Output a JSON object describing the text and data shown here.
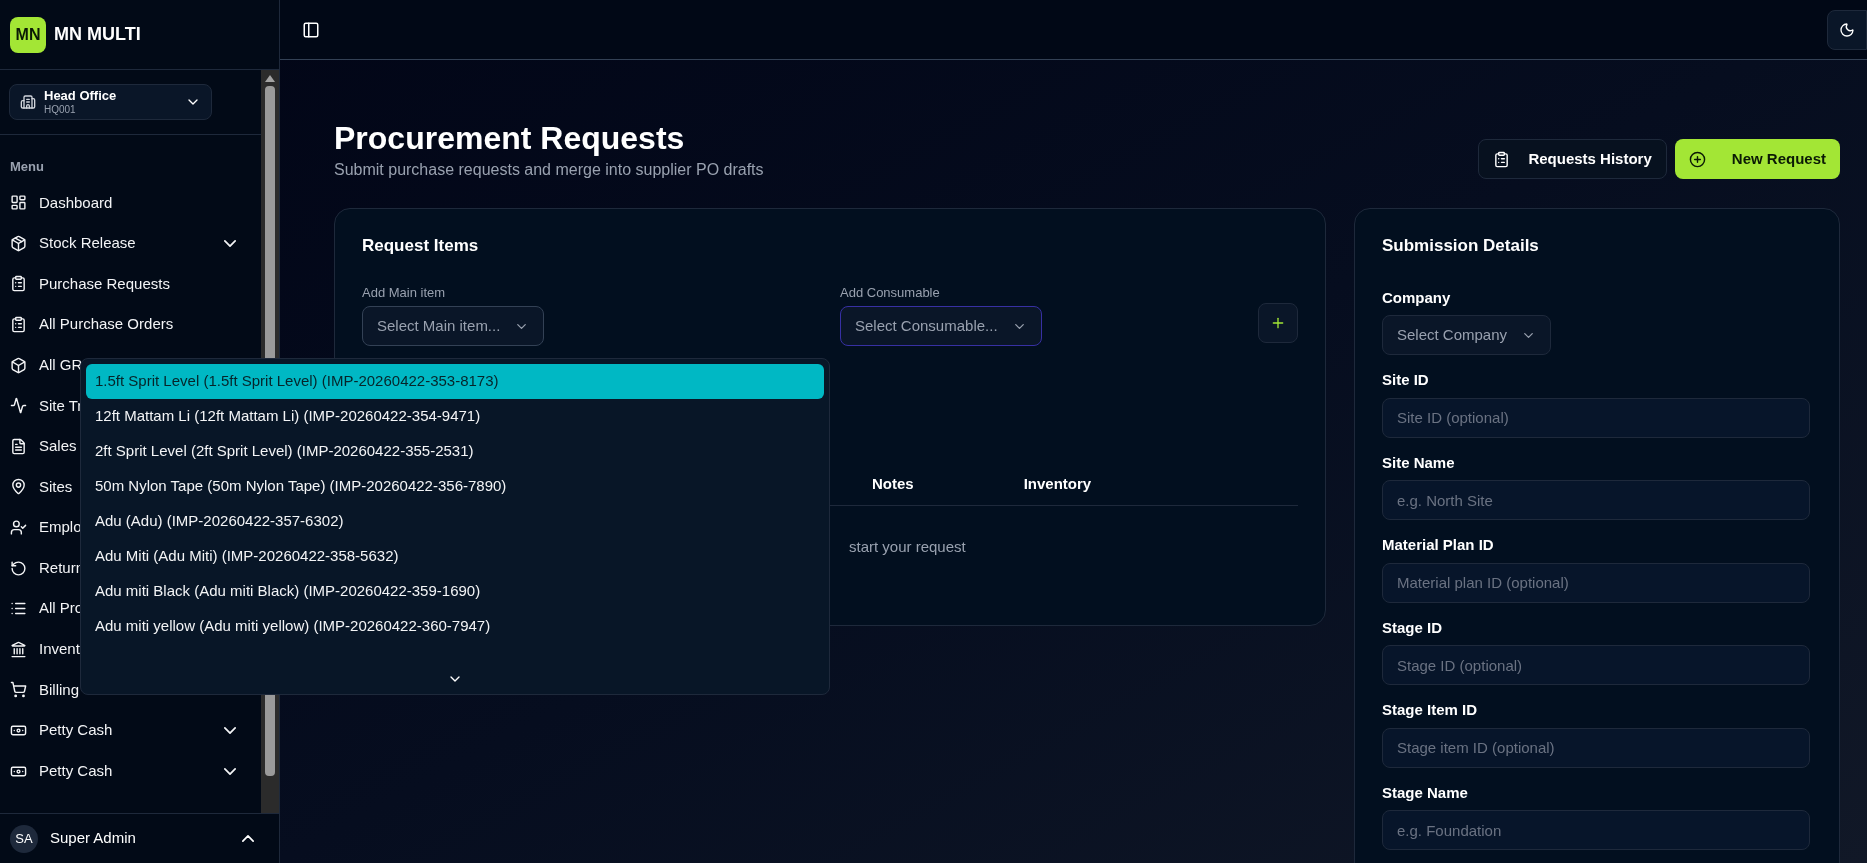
{
  "brand": {
    "initials": "MN",
    "name": "MN MULTI"
  },
  "branch": {
    "name": "Head Office",
    "code": "HQ001"
  },
  "sidebar": {
    "heading": "Menu",
    "items": [
      {
        "label": "Dashboard",
        "has_submenu": false
      },
      {
        "label": "Stock Release",
        "has_submenu": true
      },
      {
        "label": "Purchase Requests",
        "has_submenu": false
      },
      {
        "label": "All Purchase Orders",
        "has_submenu": false
      },
      {
        "label": "All GR",
        "has_submenu": false
      },
      {
        "label": "Site Tr",
        "has_submenu": false
      },
      {
        "label": "Sales",
        "has_submenu": false
      },
      {
        "label": "Sites",
        "has_submenu": false
      },
      {
        "label": "Emplo",
        "has_submenu": false
      },
      {
        "label": "Return",
        "has_submenu": false
      },
      {
        "label": "All Pro",
        "has_submenu": false
      },
      {
        "label": "Invent",
        "has_submenu": false
      },
      {
        "label": "Billing",
        "has_submenu": false
      },
      {
        "label": "Petty Cash",
        "has_submenu": true
      },
      {
        "label": "Petty Cash",
        "has_submenu": true
      }
    ],
    "user": {
      "initials": "SA",
      "name": "Super Admin"
    }
  },
  "page": {
    "title": "Procurement Requests",
    "subtitle": "Submit purchase requests and merge into supplier PO drafts",
    "buttons": [
      {
        "label": "Requests History",
        "kind": "outline"
      },
      {
        "label": "New Request",
        "kind": "primary"
      }
    ]
  },
  "request_items": {
    "title": "Request Items",
    "main_item": {
      "label": "Add Main item",
      "placeholder": "Select Main item..."
    },
    "consumable": {
      "label": "Add Consumable",
      "placeholder": "Select Consumable..."
    },
    "columns": [
      "Notes",
      "Inventory"
    ],
    "empty_message": "start your request"
  },
  "dropdown": {
    "options": [
      {
        "label": "1.5ft Sprit Level (1.5ft Sprit Level) (IMP-20260422-353-8173)",
        "selected": true
      },
      {
        "label": "12ft Mattam Li (12ft Mattam Li) (IMP-20260422-354-9471)",
        "selected": false
      },
      {
        "label": "2ft Sprit Level (2ft Sprit Level) (IMP-20260422-355-2531)",
        "selected": false
      },
      {
        "label": "50m Nylon Tape (50m Nylon Tape) (IMP-20260422-356-7890)",
        "selected": false
      },
      {
        "label": "Adu (Adu) (IMP-20260422-357-6302)",
        "selected": false
      },
      {
        "label": "Adu Miti (Adu Miti) (IMP-20260422-358-5632)",
        "selected": false
      },
      {
        "label": "Adu miti Black (Adu miti Black) (IMP-20260422-359-1690)",
        "selected": false
      },
      {
        "label": "Adu miti yellow (Adu miti yellow) (IMP-20260422-360-7947)",
        "selected": false
      }
    ]
  },
  "submission": {
    "title": "Submission Details",
    "company": {
      "label": "Company",
      "placeholder": "Select Company"
    },
    "fields": [
      {
        "label": "Site ID",
        "placeholder": "Site ID (optional)"
      },
      {
        "label": "Site Name",
        "placeholder": "e.g. North Site"
      },
      {
        "label": "Material Plan ID",
        "placeholder": "Material plan ID (optional)"
      },
      {
        "label": "Stage ID",
        "placeholder": "Stage ID (optional)"
      },
      {
        "label": "Stage Item ID",
        "placeholder": "Stage item ID (optional)"
      },
      {
        "label": "Stage Name",
        "placeholder": "e.g. Foundation"
      }
    ]
  }
}
